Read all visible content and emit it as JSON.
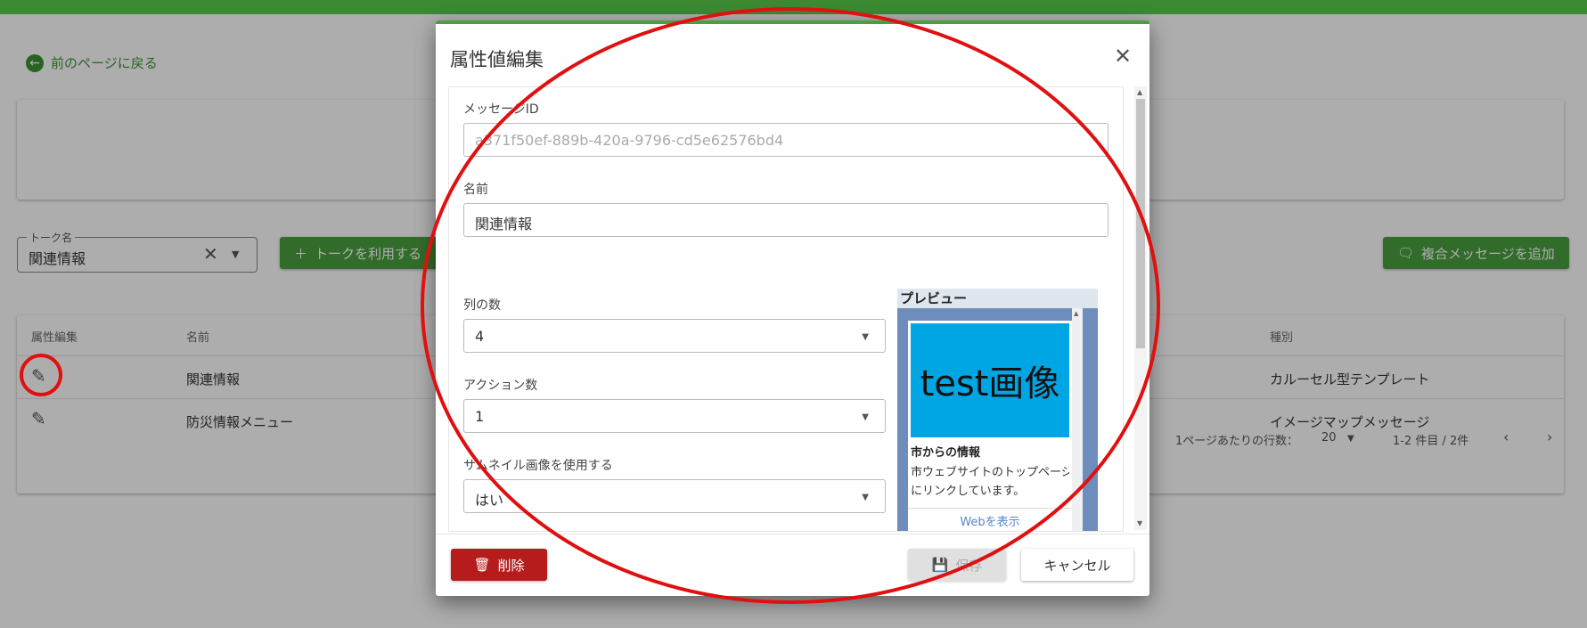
{
  "page": {
    "back_label": "前のページに戻る",
    "talk_field": {
      "label": "トーク名",
      "value": "関連情報"
    },
    "use_talk_button": "トークを利用する",
    "add_composite_button": "複合メッセージを追加",
    "table": {
      "headers": {
        "edit": "属性編集",
        "name": "名前",
        "type": "種別"
      },
      "rows": [
        {
          "name": "関連情報",
          "type": "カルーセル型テンプレート"
        },
        {
          "name": "防災情報メニュー",
          "type": "イメージマップメッセージ"
        }
      ],
      "rows_per_page_label": "1ページあたりの行数：",
      "rows_per_page": "20",
      "range": "1-2 件目 / 2件"
    }
  },
  "dialog": {
    "title": "属性値編集",
    "message_id_label": "メッセージID",
    "message_id": "a371f50ef-889b-420a-9796-cd5e62576bd4",
    "name_label": "名前",
    "name_value": "関連情報",
    "columns_label": "列の数",
    "columns_value": "4",
    "actions_label": "アクション数",
    "actions_value": "1",
    "thumbnail_label": "サムネイル画像を使用する",
    "thumbnail_value": "はい",
    "preview": {
      "header": "プレビュー",
      "image_text": "test画像",
      "title": "市からの情報",
      "text_line1": "市ウェブサイトのトップページ",
      "text_line2": "にリンクしています。",
      "link": "Webを表示"
    },
    "delete_label": "削除",
    "save_label": "保存",
    "cancel_label": "キャンセル"
  },
  "colors": {
    "brand_green": "#3b8a32",
    "button_green": "#4aa03f",
    "delete_red": "#b71c1c",
    "annotation_red": "#e01010",
    "preview_image_bg": "#00a5e3"
  }
}
